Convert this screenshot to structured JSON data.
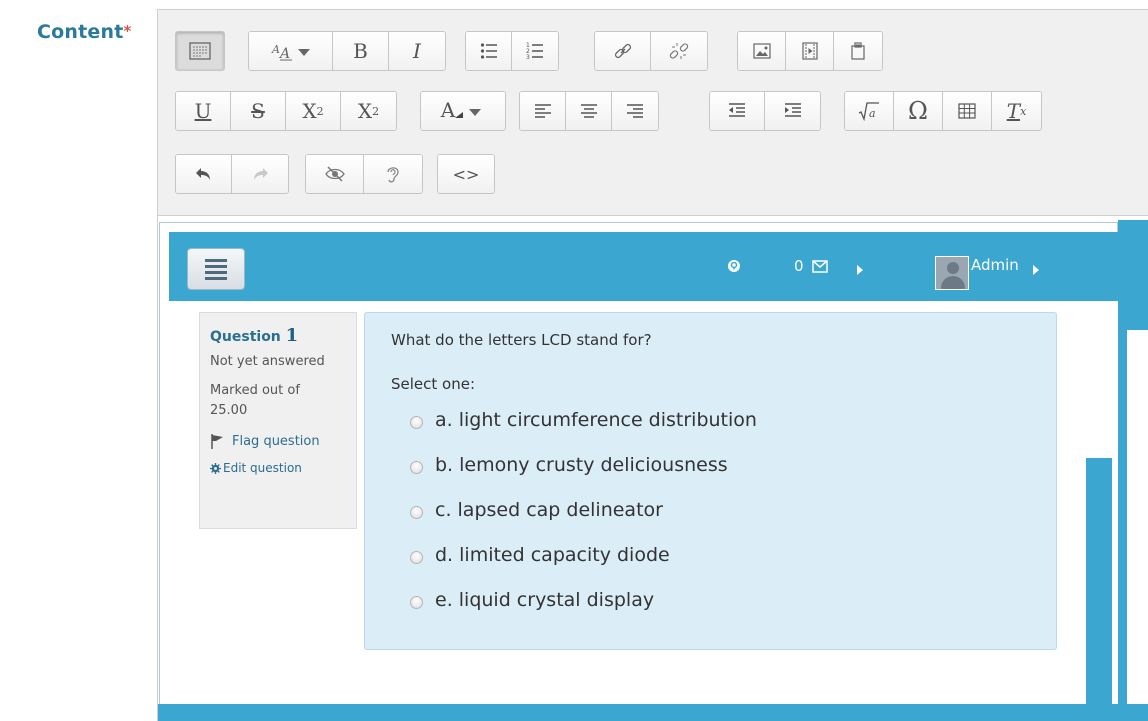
{
  "field": {
    "label": "Content",
    "required_marker": "*"
  },
  "toolbar": {
    "row1": [
      {
        "name": "toolbar-toggle-button",
        "icon": "toolbar-toggle-icon"
      },
      {
        "name": "font-size-button",
        "icon": "font-size-icon"
      },
      {
        "name": "bold-button",
        "text": "B"
      },
      {
        "name": "italic-button",
        "text": "I"
      },
      {
        "name": "bullet-list-button",
        "icon": "bullet-list-icon"
      },
      {
        "name": "numbered-list-button",
        "icon": "numbered-list-icon"
      },
      {
        "name": "link-button",
        "icon": "link-icon"
      },
      {
        "name": "unlink-button",
        "icon": "unlink-icon"
      },
      {
        "name": "insert-image-button",
        "icon": "image-icon"
      },
      {
        "name": "insert-media-button",
        "icon": "media-icon"
      },
      {
        "name": "manage-files-button",
        "icon": "files-icon"
      }
    ],
    "row2": [
      {
        "name": "underline-button",
        "text": "U"
      },
      {
        "name": "strikethrough-button",
        "text": "S"
      },
      {
        "name": "subscript-button",
        "text": "X",
        "sub": "2"
      },
      {
        "name": "superscript-button",
        "text": "X",
        "sup": "2"
      },
      {
        "name": "text-color-button",
        "text": "A"
      },
      {
        "name": "align-left-button",
        "icon": "align-left-icon"
      },
      {
        "name": "align-center-button",
        "icon": "align-center-icon"
      },
      {
        "name": "align-right-button",
        "icon": "align-right-icon"
      },
      {
        "name": "outdent-button",
        "icon": "outdent-icon"
      },
      {
        "name": "indent-button",
        "icon": "indent-icon"
      },
      {
        "name": "equation-button",
        "icon": "equation-icon"
      },
      {
        "name": "special-char-button",
        "text": "Ω"
      },
      {
        "name": "table-button",
        "icon": "table-icon"
      },
      {
        "name": "clear-formatting-button",
        "text": "T",
        "sub": "x"
      }
    ],
    "row3": [
      {
        "name": "undo-button",
        "icon": "undo-icon"
      },
      {
        "name": "redo-button",
        "icon": "redo-icon"
      },
      {
        "name": "accessibility-checker-button",
        "icon": "eye-slash-icon"
      },
      {
        "name": "screen-reader-helper-button",
        "icon": "ear-icon"
      },
      {
        "name": "html-source-button",
        "text": "<>"
      }
    ]
  },
  "nav": {
    "message_count": "0",
    "user_name": "Admin"
  },
  "question": {
    "label": "Question",
    "number": "1",
    "state": "Not yet answered",
    "grade_line1": "Marked out of",
    "grade_line2": "25.00",
    "flag_label": "Flag question",
    "edit_label": "Edit question",
    "text": "What do the letters LCD stand for?",
    "prompt": "Select one:",
    "answers": [
      "a. light circumference distribution",
      "b. lemony crusty deliciousness",
      "c. lapsed cap delineator",
      "d. limited capacity diode",
      "e. liquid crystal display"
    ]
  },
  "colors": {
    "accent": "#3ba7d1",
    "label": "#2a7a9d",
    "required": "#d9534f",
    "question_bg": "#dbedf7"
  }
}
